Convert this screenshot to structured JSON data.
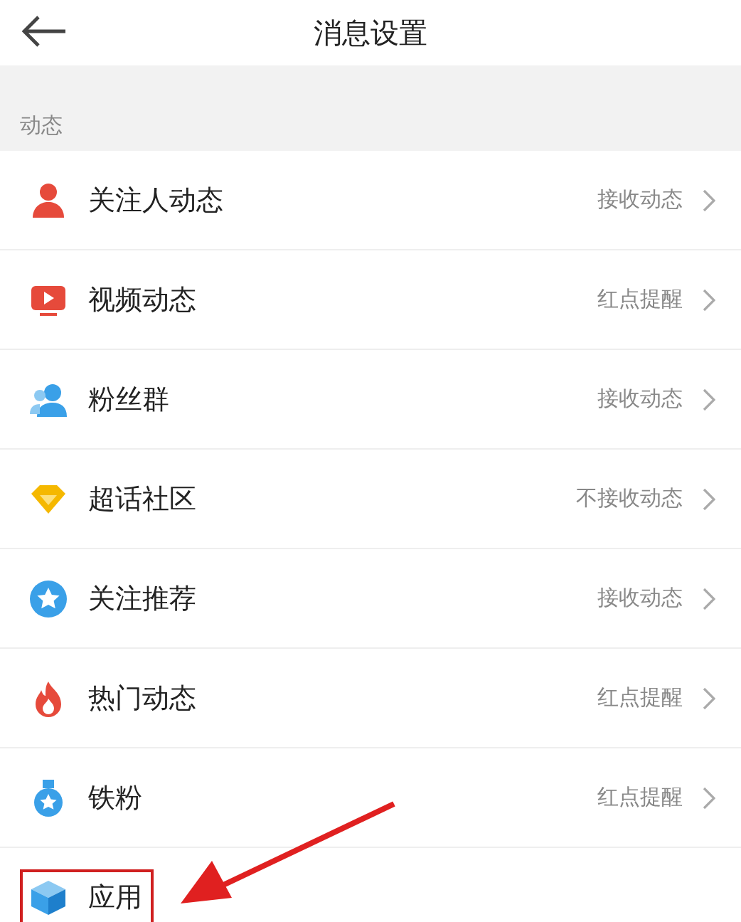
{
  "header": {
    "title": "消息设置"
  },
  "section": {
    "title": "动态"
  },
  "rows": [
    {
      "label": "关注人动态",
      "value": "接收动态",
      "highlighted": false
    },
    {
      "label": "视频动态",
      "value": "红点提醒",
      "highlighted": false
    },
    {
      "label": "粉丝群",
      "value": "接收动态",
      "highlighted": false
    },
    {
      "label": "超话社区",
      "value": "不接收动态",
      "highlighted": false
    },
    {
      "label": "关注推荐",
      "value": "接收动态",
      "highlighted": false
    },
    {
      "label": "热门动态",
      "value": "红点提醒",
      "highlighted": false
    },
    {
      "label": "铁粉",
      "value": "红点提醒",
      "highlighted": false
    },
    {
      "label": "应用",
      "highlighted": true
    }
  ]
}
